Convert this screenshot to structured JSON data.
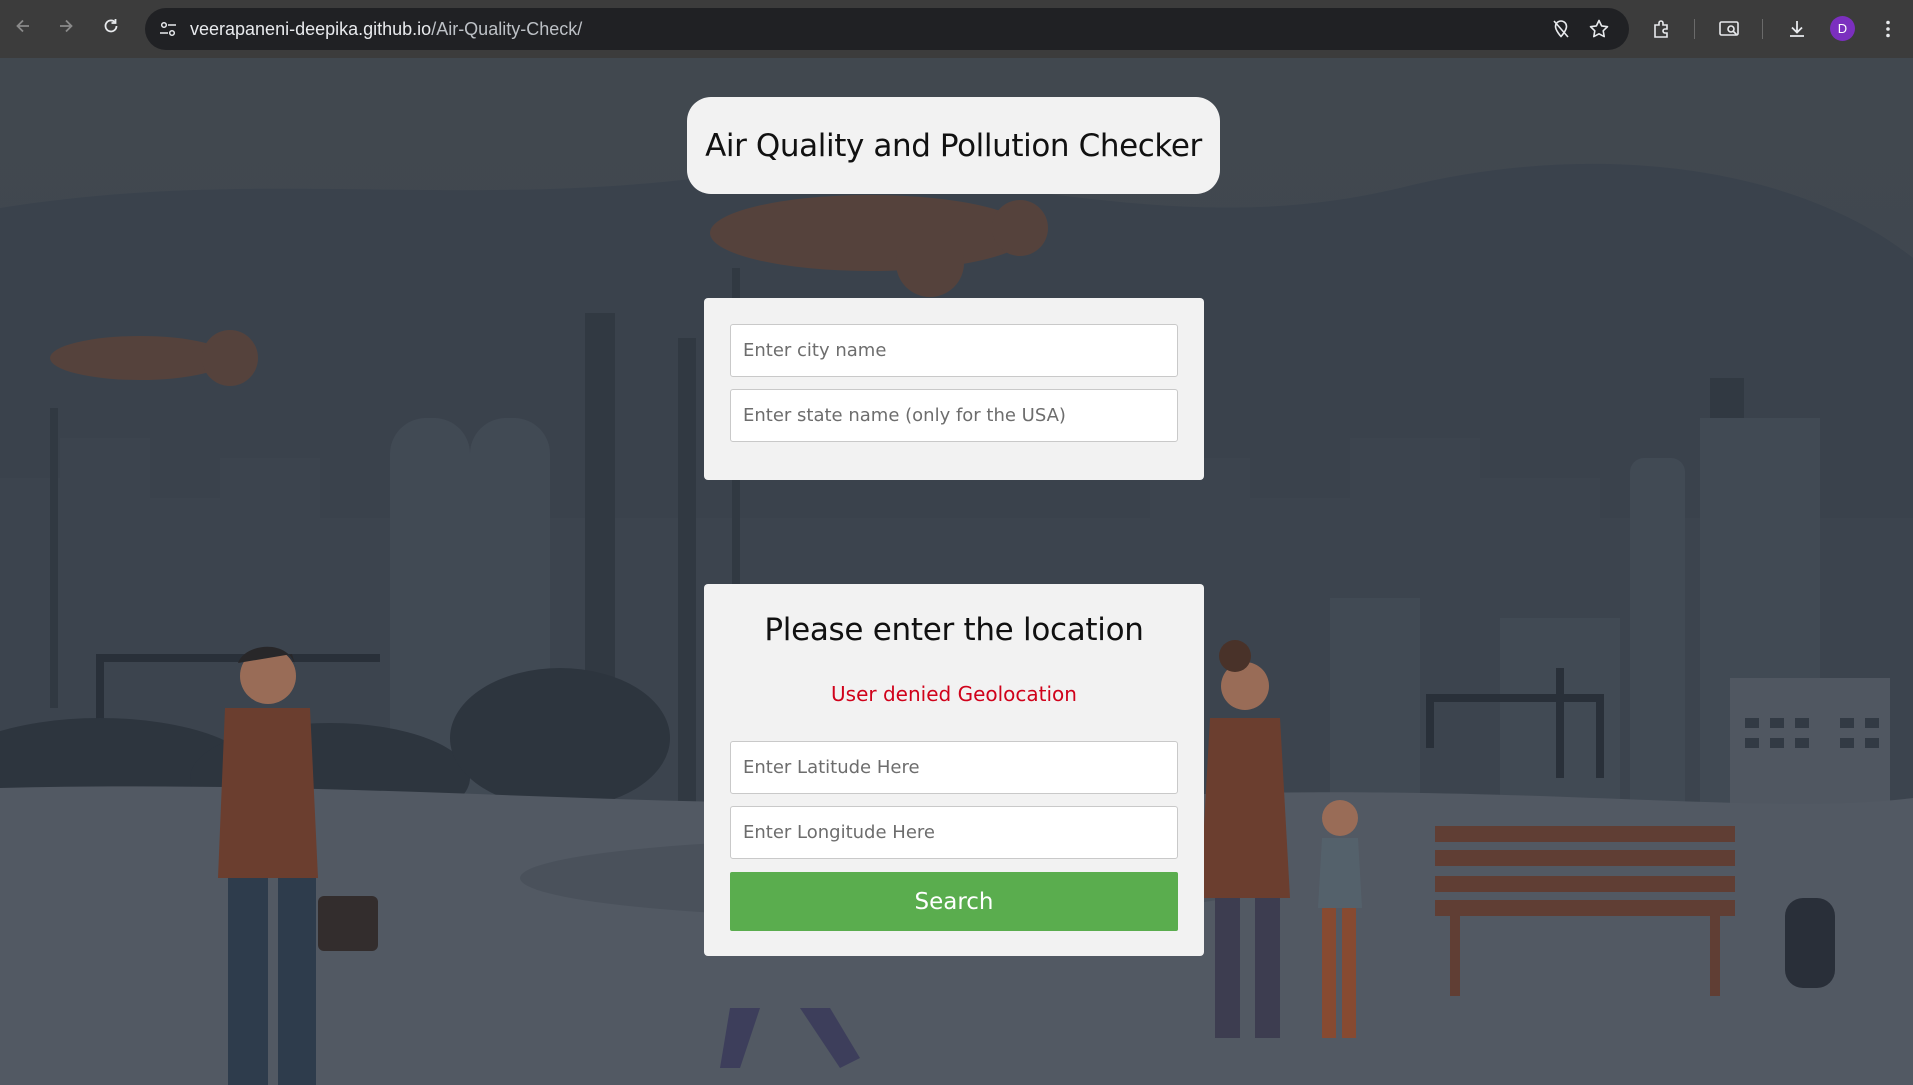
{
  "browser": {
    "url_host": "veerapaneni-deepika.github.io",
    "url_path": "/Air-Quality-Check/",
    "profile_initial": "D",
    "icons": [
      "back-arrow-icon",
      "forward-arrow-icon",
      "reload-icon",
      "site-settings-icon",
      "location-blocked-icon",
      "bookmark-star-icon",
      "extensions-icon",
      "cast-icon",
      "download-icon",
      "kebab-menu-icon"
    ]
  },
  "page": {
    "title": "Air Quality and Pollution Checker",
    "city_form": {
      "city_placeholder": "Enter city name",
      "state_placeholder": "Enter state name (only for the USA)"
    },
    "location_form": {
      "heading": "Please enter the location",
      "error": "User denied Geolocation",
      "latitude_placeholder": "Enter Latitude Here",
      "longitude_placeholder": "Enter Longitude Here",
      "search_label": "Search"
    }
  },
  "colors": {
    "search_button": "#5aad4e",
    "error_text": "#d0021b",
    "card_background": "#f2f2f2",
    "avatar": "#7b2fbf"
  }
}
